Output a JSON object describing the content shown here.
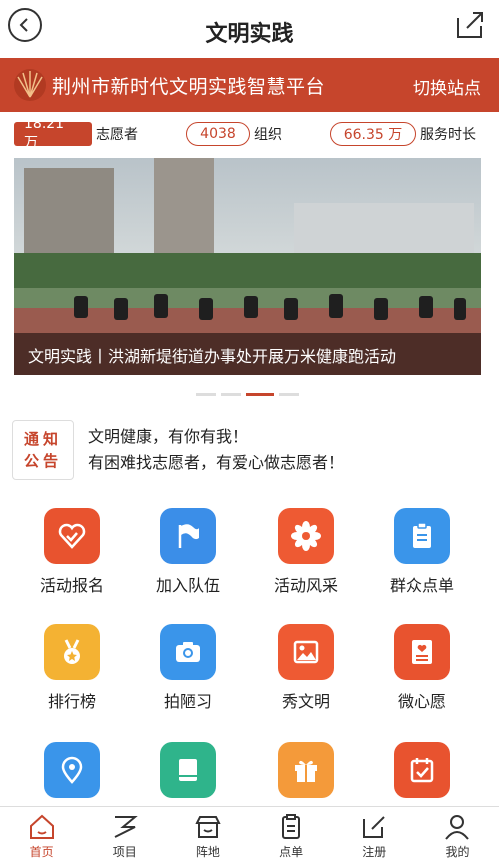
{
  "header": {
    "title": "文明实践"
  },
  "banner": {
    "platform_name": "荆州市新时代文明实践智慧平台",
    "switch_label": "切换站点"
  },
  "stats": [
    {
      "value": "18.21 万",
      "label": "志愿者"
    },
    {
      "value": "4038",
      "label": "组织"
    },
    {
      "value": "66.35 万",
      "label": "服务时长"
    }
  ],
  "carousel": {
    "caption": "文明实践丨洪湖新堤街道办事处开展万米健康跑活动",
    "active_index": 2,
    "count": 4
  },
  "notice": {
    "tag_line1": "通知",
    "tag_line2": "公告",
    "line1": "文明健康，有你有我！",
    "line2": "有困难找志愿者，有爱心做志愿者！"
  },
  "menu": [
    {
      "label": "活动报名",
      "icon": "heart-icon",
      "color": "#e8532f"
    },
    {
      "label": "加入队伍",
      "icon": "flag-icon",
      "color": "#3b8ee8"
    },
    {
      "label": "活动风采",
      "icon": "flower-icon",
      "color": "#ee5a33"
    },
    {
      "label": "群众点单",
      "icon": "clipboard-icon",
      "color": "#3a95ea"
    },
    {
      "label": "排行榜",
      "icon": "medal-icon",
      "color": "#f4b233"
    },
    {
      "label": "拍陋习",
      "icon": "camera-icon",
      "color": "#3a95ea"
    },
    {
      "label": "秀文明",
      "icon": "picture-icon",
      "color": "#ee5a33"
    },
    {
      "label": "微心愿",
      "icon": "wish-card-icon",
      "color": "#e8532f"
    },
    {
      "label": "",
      "icon": "location-icon",
      "color": "#3a95ea"
    },
    {
      "label": "",
      "icon": "book-icon",
      "color": "#2fb48b"
    },
    {
      "label": "",
      "icon": "gift-icon",
      "color": "#f49a3a"
    },
    {
      "label": "",
      "icon": "calendar-check-icon",
      "color": "#e8532f"
    }
  ],
  "tabbar": [
    {
      "label": "首页",
      "icon": "home-icon",
      "active": true
    },
    {
      "label": "项目",
      "icon": "project-icon",
      "active": false
    },
    {
      "label": "阵地",
      "icon": "store-icon",
      "active": false
    },
    {
      "label": "点单",
      "icon": "order-icon",
      "active": false
    },
    {
      "label": "注册",
      "icon": "register-icon",
      "active": false
    },
    {
      "label": "我的",
      "icon": "profile-icon",
      "active": false
    }
  ]
}
